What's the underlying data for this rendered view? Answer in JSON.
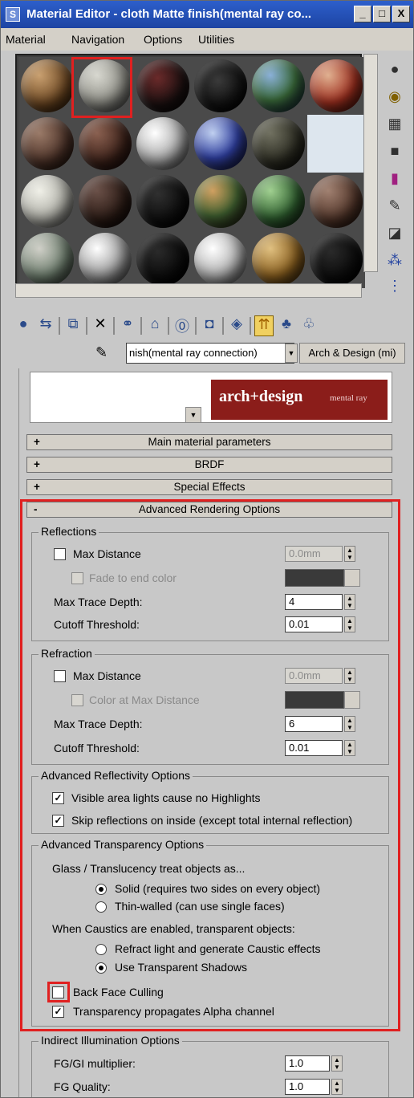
{
  "window": {
    "title": "Material Editor - cloth Matte finish(mental ray co...",
    "minimize": "_",
    "maximize": "□",
    "close": "X"
  },
  "menu": [
    "Material",
    "Navigation",
    "Options",
    "Utilities"
  ],
  "name_field": "nish(mental ray connection)",
  "type_button": "Arch & Design (mi)",
  "logo": {
    "main": "arch+design",
    "sub": "mental ray"
  },
  "rollouts": [
    {
      "sign": "+",
      "label": "Main material parameters"
    },
    {
      "sign": "+",
      "label": "BRDF"
    },
    {
      "sign": "+",
      "label": "Special Effects"
    },
    {
      "sign": "-",
      "label": "Advanced Rendering Options"
    }
  ],
  "reflections": {
    "title": "Reflections",
    "max_distance_label": "Max Distance",
    "max_distance_value": "0.0mm",
    "fade_label": "Fade to end color",
    "max_trace_label": "Max Trace Depth:",
    "max_trace_value": "4",
    "cutoff_label": "Cutoff Threshold:",
    "cutoff_value": "0.01"
  },
  "refraction": {
    "title": "Refraction",
    "max_distance_label": "Max Distance",
    "max_distance_value": "0.0mm",
    "color_label": "Color at Max Distance",
    "max_trace_label": "Max Trace Depth:",
    "max_trace_value": "6",
    "cutoff_label": "Cutoff Threshold:",
    "cutoff_value": "0.01"
  },
  "adv_reflectivity": {
    "title": "Advanced Reflectivity Options",
    "opt1": "Visible area lights cause no Highlights",
    "opt2": "Skip reflections on inside (except total internal reflection)"
  },
  "adv_transparency": {
    "title": "Advanced Transparency Options",
    "glass_label": "Glass / Translucency treat objects as...",
    "solid": "Solid (requires two sides on every object)",
    "thin": "Thin-walled (can use single faces)",
    "caustics_label": "When Caustics are enabled, transparent objects:",
    "refract": "Refract light and generate Caustic effects",
    "transparent_shadows": "Use Transparent Shadows",
    "back_face": "Back Face Culling",
    "alpha": "Transparency propagates Alpha channel"
  },
  "indirect": {
    "title": "Indirect Illumination Options",
    "fg_label": "FG/GI multiplier:",
    "fg_value": "1.0",
    "fgq_label": "FG Quality:",
    "fgq_value": "1.0"
  },
  "checkmark": "✓"
}
